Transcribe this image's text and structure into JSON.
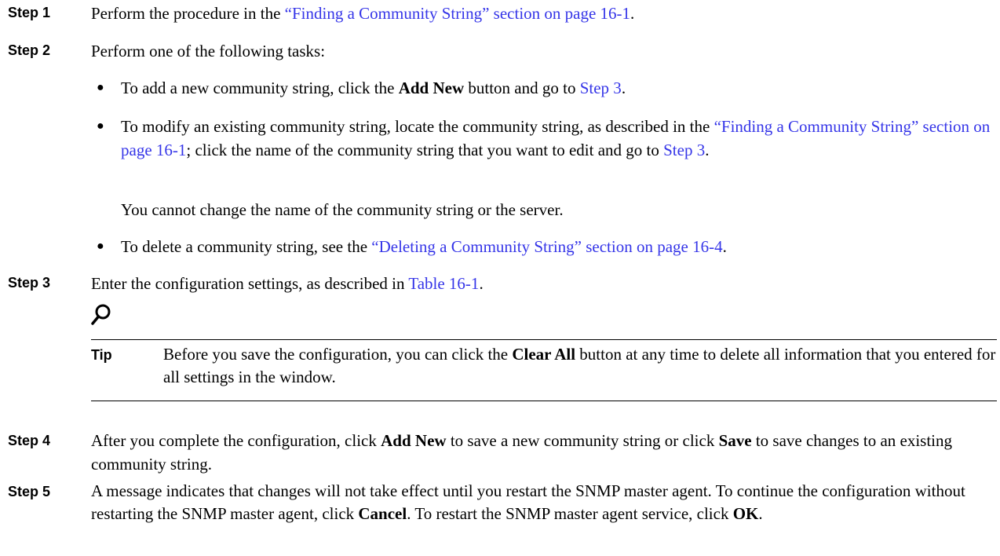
{
  "steps": {
    "s1": {
      "label": "Step 1",
      "t1": "Perform the procedure in the ",
      "link": "“Finding a Community String” section on page 16-1",
      "t2": "."
    },
    "s2": {
      "label": "Step 2",
      "text": "Perform one of the following tasks:",
      "b1": {
        "t1": "To add a new community string, click the ",
        "bold": "Add New",
        "t2": " button and go to ",
        "link": "Step 3",
        "t3": "."
      },
      "b2": {
        "t1": "To modify an existing community string, locate the community string, as described in the ",
        "link1": "“Finding a Community String” section on page 16-1",
        "t2": "; click the name of the community string that you want to edit and go to ",
        "link2": "Step 3",
        "t3": ".",
        "note": "You cannot change the name of the community string or the server."
      },
      "b3": {
        "t1": "To delete a community string, see the ",
        "link": "“Deleting a Community String” section on page 16-4",
        "t2": "."
      }
    },
    "s3": {
      "label": "Step 3",
      "t1": "Enter the configuration settings, as described in ",
      "link": "Table 16-1",
      "t2": "."
    },
    "tip": {
      "label": "Tip",
      "t1": "Before you save the configuration, you can click the ",
      "bold": "Clear All",
      "t2": " button at any time to delete all information that you entered for all settings in the window."
    },
    "s4": {
      "label": "Step 4",
      "t1": "After you complete the configuration, click ",
      "b1": "Add New",
      "t2": " to save a new community string or click ",
      "b2": "Save",
      "t3": " to save changes to an existing community string."
    },
    "s5": {
      "label": "Step 5",
      "t1": "A message indicates that changes will not take effect until you restart the SNMP master agent. To continue the configuration without restarting the SNMP master agent, click ",
      "b1": "Cancel",
      "t2": ". To restart the SNMP master agent service, click ",
      "b2": "OK",
      "t3": "."
    }
  },
  "colors": {
    "link": "#3535e8"
  },
  "icons": {
    "tip": "magnifier-icon"
  }
}
